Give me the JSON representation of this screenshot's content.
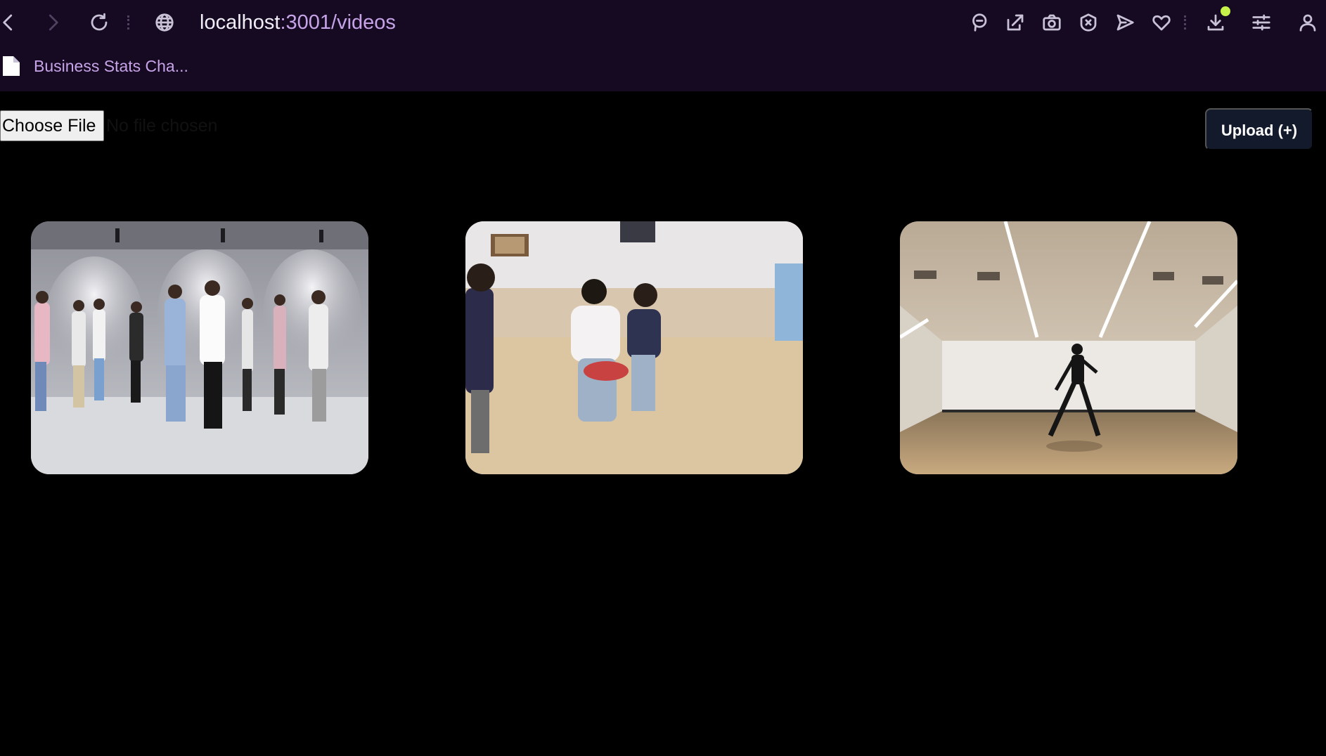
{
  "browser": {
    "url_host": "localhost",
    "url_path": ":3001/videos",
    "nav_icons": [
      "back-icon",
      "forward-icon",
      "reload-icon",
      "globe-icon"
    ],
    "toolbar_icons": [
      "search-minus-icon",
      "share-icon",
      "camera-icon",
      "shield-x-icon",
      "send-icon",
      "heart-icon",
      "download-icon",
      "sliders-icon",
      "account-icon"
    ],
    "download_badge_color": "#c6f04a",
    "bookmarks": [
      {
        "label": "Business Stats Cha...",
        "icon": "document-icon"
      }
    ]
  },
  "upload": {
    "choose_file_label": "Choose File",
    "file_status": "No file chosen",
    "upload_button_label": "Upload (+)"
  },
  "videos": [
    {
      "scene": "dance-studio-group"
    },
    {
      "scene": "dance-class-kids"
    },
    {
      "scene": "solo-dancer-hall"
    }
  ],
  "colors": {
    "browser_bg": "#150a21",
    "page_bg": "#000000",
    "url_path": "#c7a3e8",
    "upload_button_bg": "#131a2b"
  }
}
